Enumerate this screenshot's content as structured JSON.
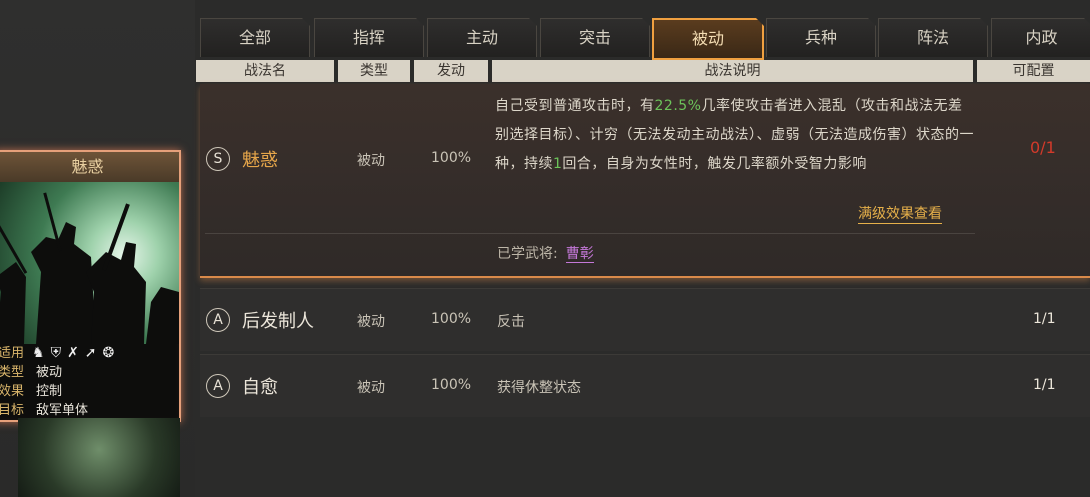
{
  "card": {
    "title": "魅惑",
    "rows": [
      {
        "key": "适用",
        "val": ""
      },
      {
        "key": "类型",
        "val": "被动"
      },
      {
        "key": "效果",
        "val": "控制"
      },
      {
        "key": "目标",
        "val": "敌军单体"
      }
    ],
    "troop_icons": [
      "cavalry-icon",
      "shield-icon",
      "bow-icon",
      "spear-icon",
      "wheel-icon"
    ]
  },
  "tabs": [
    "全部",
    "指挥",
    "主动",
    "突击",
    "被动",
    "兵种",
    "阵法",
    "内政"
  ],
  "active_tab": "被动",
  "headers": {
    "name": "战法名",
    "type": "类型",
    "rate": "发动",
    "desc": "战法说明",
    "config": "可配置"
  },
  "skills": [
    {
      "grade": "S",
      "name": "魅惑",
      "type": "被动",
      "rate": "100%",
      "desc_parts": [
        "自己受到普通攻击时，有",
        "22.5%",
        "几率使攻击者进入混乱（攻击和战法无差别选择目标）、计穷（无法发动主动战法）、虚弱（无法造成伤害）状态的一种，持续",
        "1",
        "回合，自身为女性时，触发几率额外受智力影响"
      ],
      "full_link": "满级效果查看",
      "learned_label": "已学武将:",
      "learned_general": "曹彰",
      "config": "0/1",
      "name_color": "#e6a64a",
      "config_color": "#d23a2a"
    },
    {
      "grade": "A",
      "name": "后发制人",
      "type": "被动",
      "rate": "100%",
      "desc": "反击",
      "config": "1/1"
    },
    {
      "grade": "A",
      "name": "自愈",
      "type": "被动",
      "rate": "100%",
      "desc": "获得休整状态",
      "config": "1/1"
    }
  ]
}
